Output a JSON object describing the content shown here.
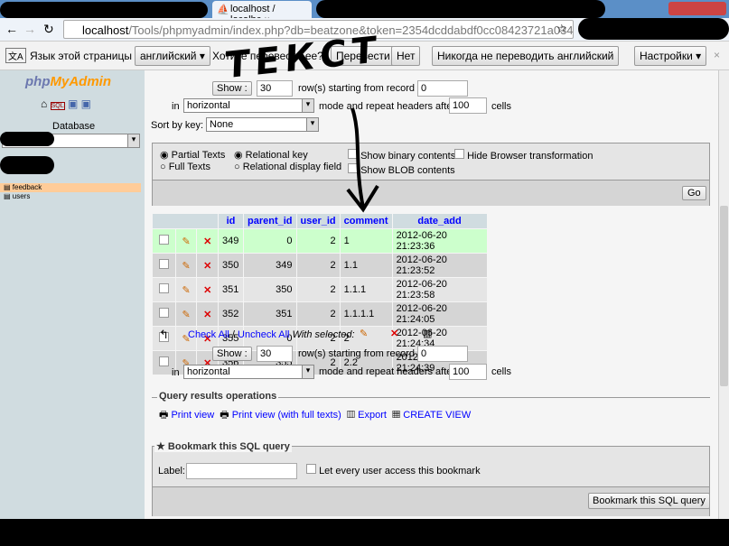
{
  "browser": {
    "tab_title": "localhost / localhc",
    "url_host": "localhost",
    "url_path": "/Tools/phpmyadmin/index.php?db=beatzone&token=2354dcddabdf0cc08423721a03437fc"
  },
  "translate_bar": {
    "label": "Язык этой страницы",
    "language": "английский",
    "question": "Хотите перевести ее?",
    "translate": "Перевести",
    "no": "Нет",
    "never": "Никогда не переводить английский",
    "settings": "Настройки"
  },
  "sidebar": {
    "logo": "phpMyAdmin",
    "db_label": "Database",
    "tables": [
      "feedback",
      "users"
    ]
  },
  "nav_top": {
    "show": "Show :",
    "rows": "30",
    "starting": "row(s) starting from record #",
    "record": "0",
    "in": "in",
    "mode": "horizontal",
    "repeat": "mode and repeat headers after",
    "headers": "100",
    "cells": "cells",
    "sort_label": "Sort by key:",
    "sort_value": "None"
  },
  "options": {
    "partial": "Partial Texts",
    "full": "Full Texts",
    "relational_key": "Relational key",
    "relational_display": "Relational display field",
    "binary": "Show binary contents",
    "blob": "Show BLOB contents",
    "hide_transform": "Hide Browser transformation",
    "go": "Go"
  },
  "table": {
    "columns": [
      "id",
      "parent_id",
      "user_id",
      "comment",
      "date_add"
    ],
    "rows": [
      [
        "349",
        "0",
        "2",
        "1",
        "2012-06-20 21:23:36"
      ],
      [
        "350",
        "349",
        "2",
        "1.1",
        "2012-06-20 21:23:52"
      ],
      [
        "351",
        "350",
        "2",
        "1.1.1",
        "2012-06-20 21:23:58"
      ],
      [
        "352",
        "351",
        "2",
        "1.1.1.1",
        "2012-06-20 21:24:05"
      ],
      [
        "355",
        "0",
        "2",
        "2",
        "2012-06-20 21:24:34"
      ],
      [
        "356",
        "355",
        "2",
        "2.2",
        "2012-06-20 21:24:39"
      ]
    ]
  },
  "bulk": {
    "check_all": "Check All",
    "sep": " / ",
    "uncheck_all": "Uncheck All",
    "with_selected": "With selected:"
  },
  "nav_bottom": {
    "show": "Show :",
    "rows": "30",
    "starting": "row(s) starting from record #",
    "record": "0",
    "in": "in",
    "mode": "horizontal",
    "repeat": "mode and repeat headers after",
    "headers": "100",
    "cells": "cells"
  },
  "query_ops": {
    "legend": "Query results operations",
    "print": "Print view",
    "print_full": "Print view (with full texts)",
    "export": "Export",
    "create_view": "CREATE VIEW"
  },
  "bookmark": {
    "legend": "Bookmark this SQL query",
    "label": "Label:",
    "label_value": "",
    "every_user": "Let every user access this bookmark",
    "button": "Bookmark this SQL query"
  },
  "annotation": "ТЕКСТ"
}
